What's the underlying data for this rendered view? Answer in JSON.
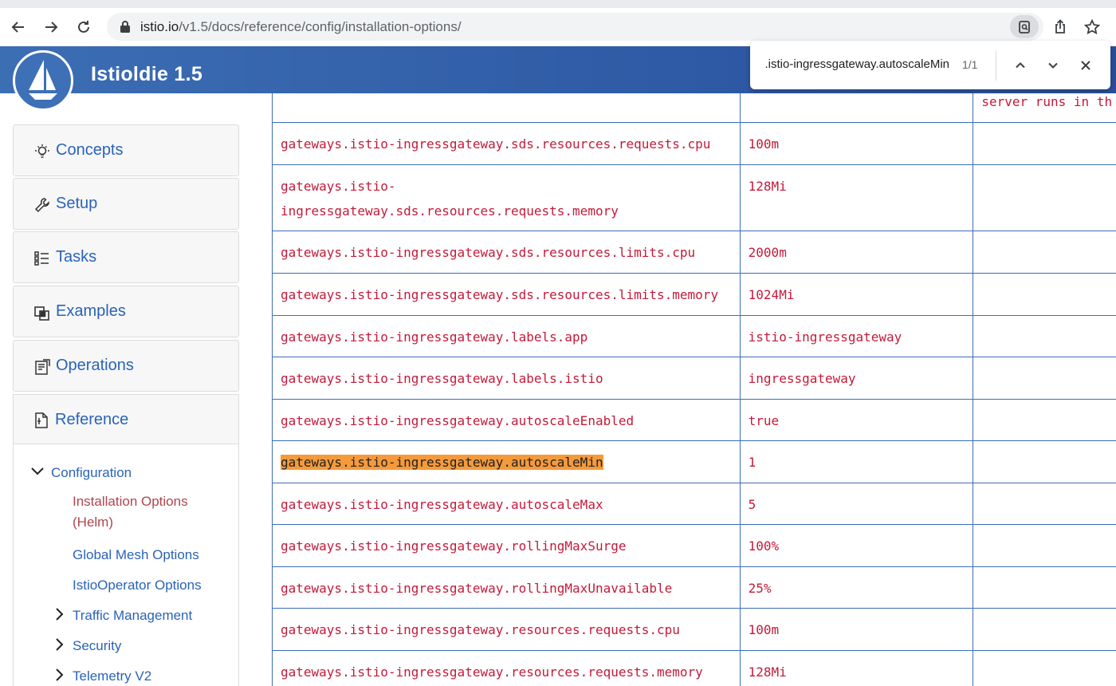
{
  "browser": {
    "url_host": "istio.io",
    "url_path": "/v1.5/docs/reference/config/installation-options/",
    "find": {
      "query": "gateways.istio-ingressgateway.autoscaleMin",
      "count": "1/1"
    }
  },
  "site": {
    "title": "Istioldie 1.5"
  },
  "sidebar": {
    "items": [
      {
        "label": "Concepts",
        "icon": "lightbulb-icon"
      },
      {
        "label": "Setup",
        "icon": "wrench-icon"
      },
      {
        "label": "Tasks",
        "icon": "list-icon"
      },
      {
        "label": "Examples",
        "icon": "examples-icon"
      },
      {
        "label": "Operations",
        "icon": "operations-icon"
      }
    ],
    "reference": {
      "label": "Reference",
      "configuration": "Configuration",
      "installation_options": "Installation Options (Helm)",
      "global_mesh": "Global Mesh Options",
      "istiooperator": "IstioOperator Options",
      "traffic": "Traffic Management",
      "security": "Security",
      "telemetry": "Telemetry V2"
    }
  },
  "table": {
    "top_partial_desc": "server runs in th",
    "rows": [
      {
        "key": "gateways.istio-ingressgateway.sds.resources.requests.cpu",
        "value": "100m"
      },
      {
        "key": "gateways.istio-ingressgateway.sds.resources.requests.memory",
        "value": "128Mi"
      },
      {
        "key": "gateways.istio-ingressgateway.sds.resources.limits.cpu",
        "value": "2000m"
      },
      {
        "key": "gateways.istio-ingressgateway.sds.resources.limits.memory",
        "value": "1024Mi"
      },
      {
        "key": "gateways.istio-ingressgateway.labels.app",
        "value": "istio-ingressgateway"
      },
      {
        "key": "gateways.istio-ingressgateway.labels.istio",
        "value": "ingressgateway"
      },
      {
        "key": "gateways.istio-ingressgateway.autoscaleEnabled",
        "value": "true"
      },
      {
        "key": "gateways.istio-ingressgateway.autoscaleMin",
        "value": "1"
      },
      {
        "key": "gateways.istio-ingressgateway.autoscaleMax",
        "value": "5"
      },
      {
        "key": "gateways.istio-ingressgateway.rollingMaxSurge",
        "value": "100%"
      },
      {
        "key": "gateways.istio-ingressgateway.rollingMaxUnavailable",
        "value": "25%"
      },
      {
        "key": "gateways.istio-ingressgateway.resources.requests.cpu",
        "value": "100m"
      },
      {
        "key": "gateways.istio-ingressgateway.resources.requests.memory",
        "value": "128Mi"
      }
    ]
  },
  "colors": {
    "header": "#3c6eb4",
    "link": "#2a63b8",
    "code": "#c41a3a",
    "highlight": "#f59a3b"
  }
}
